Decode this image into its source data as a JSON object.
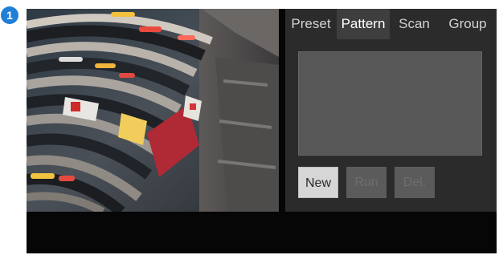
{
  "marker": {
    "number": "1"
  },
  "video": {
    "description_icon": "camera-view"
  },
  "tabs": [
    {
      "label": "Preset",
      "active": false
    },
    {
      "label": "Pattern",
      "active": true
    },
    {
      "label": "Scan",
      "active": false
    },
    {
      "label": "Group",
      "active": false
    }
  ],
  "pattern_list": {
    "items": []
  },
  "buttons": {
    "new_label": "New",
    "run_label": "Run",
    "delete_label": "Del."
  },
  "colors": {
    "marker": "#1f7fd6",
    "panel": "#2b2b2b",
    "active_tab": "#3e3e3e",
    "list_bg": "#575757",
    "enabled_button": "#d6d6d6",
    "disabled_button": "#5b5b5b"
  }
}
